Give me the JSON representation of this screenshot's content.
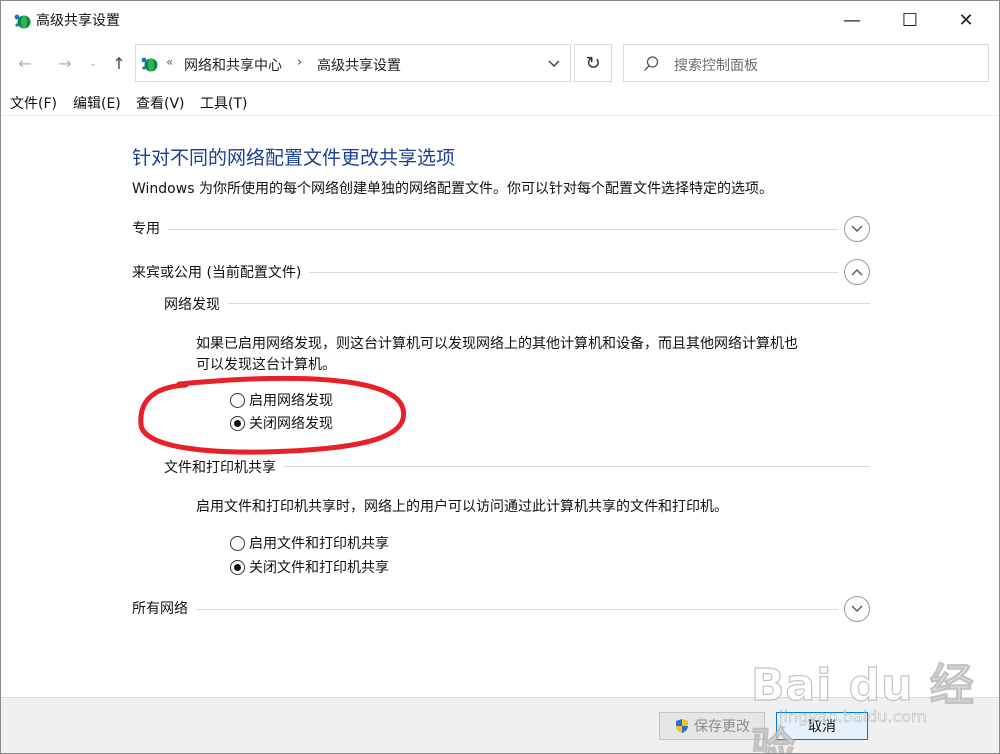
{
  "window": {
    "title": "高级共享设置",
    "minimize_glyph": "—",
    "maximize_glyph": "☐",
    "close_glyph": "✕"
  },
  "nav": {
    "back_glyph": "←",
    "forward_glyph": "→",
    "recent_glyph": "⌄",
    "up_glyph": "↑",
    "refresh_glyph": "↻"
  },
  "address": {
    "separator": "«",
    "crumbs": [
      "网络和共享中心",
      "高级共享设置"
    ],
    "arrow": "›"
  },
  "search": {
    "placeholder": "搜索控制面板"
  },
  "menu": [
    "文件(F)",
    "编辑(E)",
    "查看(V)",
    "工具(T)"
  ],
  "content": {
    "title": "针对不同的网络配置文件更改共享选项",
    "description": "Windows 为你所使用的每个网络创建单独的网络配置文件。你可以针对每个配置文件选择特定的选项。",
    "profiles": [
      {
        "label": "专用",
        "expanded": false
      },
      {
        "label": "来宾或公用 (当前配置文件)",
        "expanded": true
      },
      {
        "label": "所有网络",
        "expanded": false
      }
    ],
    "network_discovery": {
      "heading": "网络发现",
      "description_line1": "如果已启用网络发现，则这台计算机可以发现网络上的其他计算机和设备，而且其他网络计算机也",
      "description_line2": "可以发现这台计算机。",
      "options": [
        {
          "label": "启用网络发现",
          "checked": false
        },
        {
          "label": "关闭网络发现",
          "checked": true
        }
      ]
    },
    "file_printer_sharing": {
      "heading": "文件和打印机共享",
      "description": "启用文件和打印机共享时，网络上的用户可以访问通过此计算机共享的文件和打印机。",
      "options": [
        {
          "label": "启用文件和打印机共享",
          "checked": false
        },
        {
          "label": "关闭文件和打印机共享",
          "checked": true
        }
      ]
    }
  },
  "buttons": {
    "save": "保存更改",
    "cancel": "取消"
  },
  "watermark": {
    "brand": "Bai du 经验",
    "url": "jingyan.baidu.com"
  },
  "colors": {
    "title_blue": "#1b3f95",
    "annotation_red": "#e8202a",
    "accent": "#0078d7"
  },
  "icons": {
    "app": "network-globe-icon",
    "search": "search-icon",
    "shield": "uac-shield-icon"
  }
}
